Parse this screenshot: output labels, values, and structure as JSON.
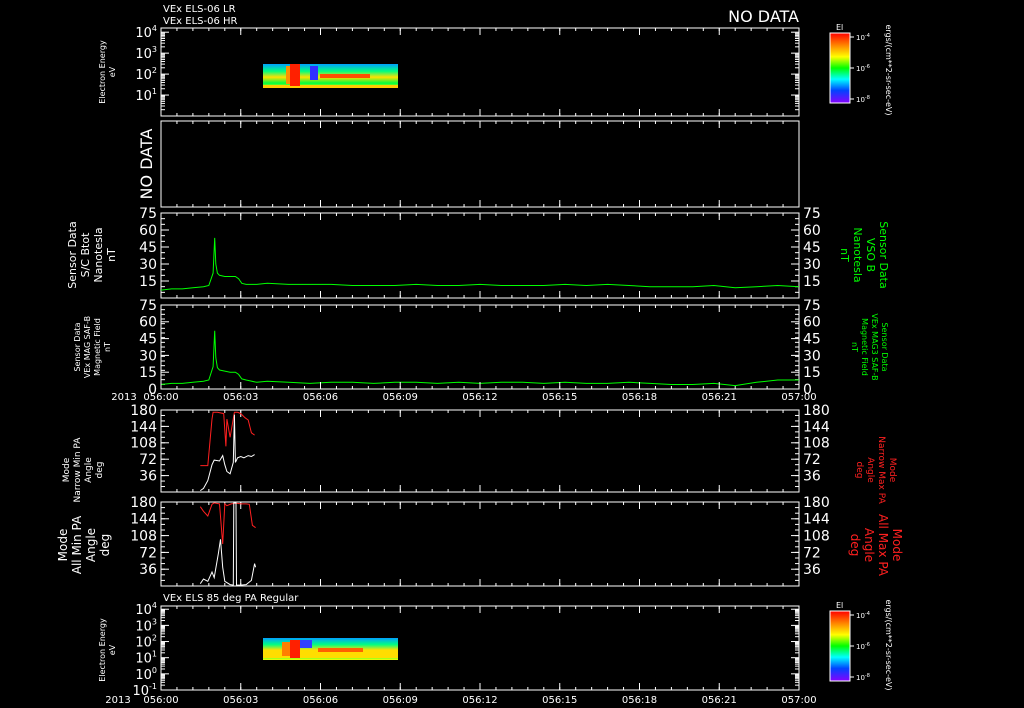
{
  "header": {
    "title_lines": [
      "VEx ELS-06 LR",
      "VEx ELS-06 HR"
    ],
    "no_data_label": "NO DATA"
  },
  "panel_nodata": {
    "label": "NO DATA"
  },
  "spectrogram_top": {
    "ylabel_lines": [
      "Electron Energy",
      "eV"
    ],
    "yticks": [
      {
        "base": "10",
        "exp": "4"
      },
      {
        "base": "10",
        "exp": "3"
      },
      {
        "base": "10",
        "exp": "2"
      },
      {
        "base": "10",
        "exp": "1"
      }
    ]
  },
  "colorbar_top": {
    "label": "El",
    "ticks": [
      {
        "base": "10",
        "exp": "-4"
      },
      {
        "base": "10",
        "exp": "-6"
      },
      {
        "base": "10",
        "exp": "-8"
      }
    ],
    "units": "ergs/(cm**2-sr-sec-eV)"
  },
  "colorbar_bottom": {
    "label": "El",
    "ticks": [
      {
        "base": "10",
        "exp": "-4"
      },
      {
        "base": "10",
        "exp": "-6"
      },
      {
        "base": "10",
        "exp": "-8"
      }
    ],
    "units": "ergs/(cm**2-sr-sec-eV)"
  },
  "mag_panel_1": {
    "left_label_lines": [
      "Sensor Data",
      "S/C Btot",
      "Nanotesla",
      "nT"
    ],
    "right_label_lines": [
      "Sensor Data",
      "VSO B",
      "Nanotesla",
      "nT"
    ],
    "yticks": [
      "75",
      "60",
      "45",
      "30",
      "15"
    ]
  },
  "mag_panel_2": {
    "left_label_lines": [
      "Sensor Data",
      "VEx MAG SAF-B",
      "Magnetic Field",
      "nT"
    ],
    "right_label_lines": [
      "Sensor Data",
      "VEx MAG3 SAF-B",
      "Magnetic Field",
      "nT"
    ],
    "yticks": [
      "75",
      "60",
      "45",
      "30",
      "15",
      "0"
    ]
  },
  "xaxis_1": {
    "year": "2013",
    "ticks": [
      "056:00",
      "056:03",
      "056:06",
      "056:09",
      "056:12",
      "056:15",
      "056:18",
      "056:21",
      "057:00"
    ]
  },
  "pa_narrow": {
    "left_label_lines": [
      "Mode",
      "Narrow Min PA",
      "Angle",
      "deg"
    ],
    "right_label_lines": [
      "Mode",
      "Narrow Max PA",
      "Angle",
      "deg"
    ],
    "left_ticks": [
      "180",
      "144",
      "108",
      "72",
      "36"
    ],
    "right_ticks": [
      "180",
      "144",
      "108",
      "72",
      "36"
    ]
  },
  "pa_all": {
    "left_label_lines": [
      "Mode",
      "All Min PA",
      "Angle",
      "deg"
    ],
    "right_label_lines": [
      "Mode",
      "All Max PA",
      "Angle",
      "deg"
    ],
    "left_ticks": [
      "180",
      "144",
      "108",
      "72",
      "36"
    ],
    "right_ticks": [
      "180",
      "144",
      "108",
      "72",
      "36"
    ]
  },
  "spectrogram_bottom": {
    "title": "VEx ELS 85 deg PA Regular",
    "ylabel_lines": [
      "Electron Energy",
      "eV"
    ],
    "yticks": [
      {
        "base": "10",
        "exp": "4"
      },
      {
        "base": "10",
        "exp": "3"
      },
      {
        "base": "10",
        "exp": "2"
      },
      {
        "base": "10",
        "exp": "1"
      },
      {
        "base": "10",
        "exp": "0"
      },
      {
        "base": "10",
        "exp": "-1"
      }
    ]
  },
  "xaxis_2": {
    "year": "2013",
    "ticks": [
      "056:00",
      "056:03",
      "056:06",
      "056:09",
      "056:12",
      "056:15",
      "056:18",
      "056:21",
      "057:00"
    ]
  },
  "colors": {
    "background": "#000000",
    "axes": "#ffffff",
    "mag_trace": "#00ff00",
    "max_pa_trace": "#ff2020",
    "min_pa_trace": "#ffffff",
    "right_label_green": "#00ff00",
    "right_label_red": "#ff2020"
  },
  "chart_data": [
    {
      "type": "heatmap",
      "name": "VEx ELS-06 LR / HR spectrogram",
      "x_range_minutes": [
        0,
        60
      ],
      "data_x_range_minutes": [
        3.7,
        8.9
      ],
      "ylim_log10_eV": [
        0,
        4
      ],
      "y_scale": "log",
      "data_y_range_log10_eV": [
        1.0,
        2.3
      ],
      "color_scale": "log",
      "color_range": [
        "1e-8",
        "1e-4"
      ]
    },
    {
      "type": "line",
      "name": "S/C Btot",
      "x_range_minutes": [
        0,
        60
      ],
      "ylim": [
        0,
        75
      ],
      "x": [
        0,
        1,
        2,
        3,
        4,
        4.5,
        4.9,
        5.05,
        5.15,
        5.3,
        5.5,
        6,
        6.5,
        7,
        7.3,
        7.6,
        8,
        9,
        10,
        12,
        14,
        16,
        18,
        20,
        22,
        24,
        26,
        28,
        30,
        32,
        34,
        36,
        38,
        40,
        42,
        44,
        46,
        48,
        50,
        52,
        54,
        56,
        58,
        60
      ],
      "y": [
        7,
        8,
        8,
        9,
        10,
        11,
        22,
        53,
        30,
        22,
        20,
        19,
        19,
        19,
        17,
        13,
        12,
        12,
        13,
        12,
        12,
        12,
        11,
        11,
        11,
        12,
        11,
        11,
        12,
        11,
        11,
        11,
        12,
        11,
        12,
        11,
        10,
        10,
        10,
        11,
        9,
        10,
        11,
        10
      ]
    },
    {
      "type": "line",
      "name": "VEx MAG SAF-B",
      "x_range_minutes": [
        0,
        60
      ],
      "ylim": [
        0,
        75
      ],
      "x": [
        0,
        1,
        2,
        3,
        4,
        4.5,
        4.9,
        5.05,
        5.15,
        5.3,
        5.5,
        6,
        6.5,
        7,
        7.3,
        7.6,
        8,
        9,
        10,
        12,
        14,
        16,
        18,
        20,
        22,
        24,
        26,
        28,
        30,
        32,
        34,
        36,
        38,
        40,
        42,
        44,
        46,
        48,
        50,
        52,
        54,
        56,
        58,
        60
      ],
      "y": [
        4,
        5,
        5,
        6,
        7,
        8,
        20,
        52,
        28,
        19,
        17,
        16,
        15,
        15,
        13,
        9,
        8,
        6,
        7,
        6,
        5,
        6,
        6,
        5,
        6,
        6,
        5,
        6,
        5,
        6,
        6,
        5,
        6,
        5,
        5,
        6,
        5,
        4,
        4,
        5,
        3,
        6,
        8,
        8
      ]
    },
    {
      "type": "line",
      "name": "Narrow PA",
      "x_range_minutes": [
        0,
        60
      ],
      "ylim": [
        0,
        180
      ],
      "series": [
        {
          "name": "Narrow Max PA",
          "x": [
            3.7,
            4.4,
            4.8,
            4.9,
            5.3,
            5.9,
            6.1,
            6.2,
            6.5,
            6.9,
            7.2,
            7.5,
            7.9,
            8.2,
            8.5,
            8.8
          ],
          "y": [
            58,
            58,
            160,
            175,
            175,
            172,
            100,
            160,
            120,
            175,
            175,
            172,
            163,
            158,
            130,
            125
          ]
        },
        {
          "name": "Narrow Min PA",
          "x": [
            3.7,
            4.0,
            4.4,
            4.8,
            5.0,
            5.5,
            5.8,
            6.0,
            6.2,
            6.5,
            6.8,
            6.9,
            7.0,
            7.2,
            7.5,
            7.8,
            8.2,
            8.5,
            8.8
          ],
          "y": [
            3,
            8,
            25,
            60,
            70,
            68,
            80,
            60,
            45,
            40,
            65,
            170,
            65,
            75,
            78,
            75,
            80,
            78,
            82
          ]
        }
      ]
    },
    {
      "type": "line",
      "name": "All PA",
      "x_range_minutes": [
        0,
        60
      ],
      "ylim": [
        0,
        180
      ],
      "series": [
        {
          "name": "All Max PA",
          "x": [
            3.7,
            4.0,
            4.4,
            4.8,
            5.0,
            5.5,
            5.8,
            6.0,
            6.2,
            6.6,
            6.9,
            7.2,
            7.5,
            8.0,
            8.3,
            8.6,
            8.9
          ],
          "y": [
            170,
            160,
            150,
            175,
            178,
            176,
            90,
            176,
            172,
            176,
            177,
            177,
            176,
            176,
            175,
            130,
            125
          ]
        },
        {
          "name": "All Min PA",
          "x": [
            3.7,
            4.0,
            4.4,
            4.8,
            5.0,
            5.4,
            5.6,
            5.8,
            6.0,
            6.5,
            6.8,
            6.85,
            7.05,
            7.1,
            7.5,
            8.0,
            8.5,
            8.8,
            8.9
          ],
          "y": [
            5,
            15,
            10,
            30,
            18,
            70,
            100,
            40,
            10,
            3,
            2,
            178,
            178,
            2,
            2,
            3,
            12,
            48,
            40
          ]
        }
      ]
    },
    {
      "type": "heatmap",
      "name": "VEx ELS 85 deg PA Regular",
      "x_range_minutes": [
        0,
        60
      ],
      "data_x_range_minutes": [
        3.7,
        8.9
      ],
      "ylim_log10_eV": [
        -1,
        4
      ],
      "y_scale": "log",
      "data_y_range_log10_eV": [
        1.0,
        2.3
      ],
      "color_scale": "log",
      "color_range": [
        "1e-8",
        "1e-4"
      ]
    }
  ]
}
